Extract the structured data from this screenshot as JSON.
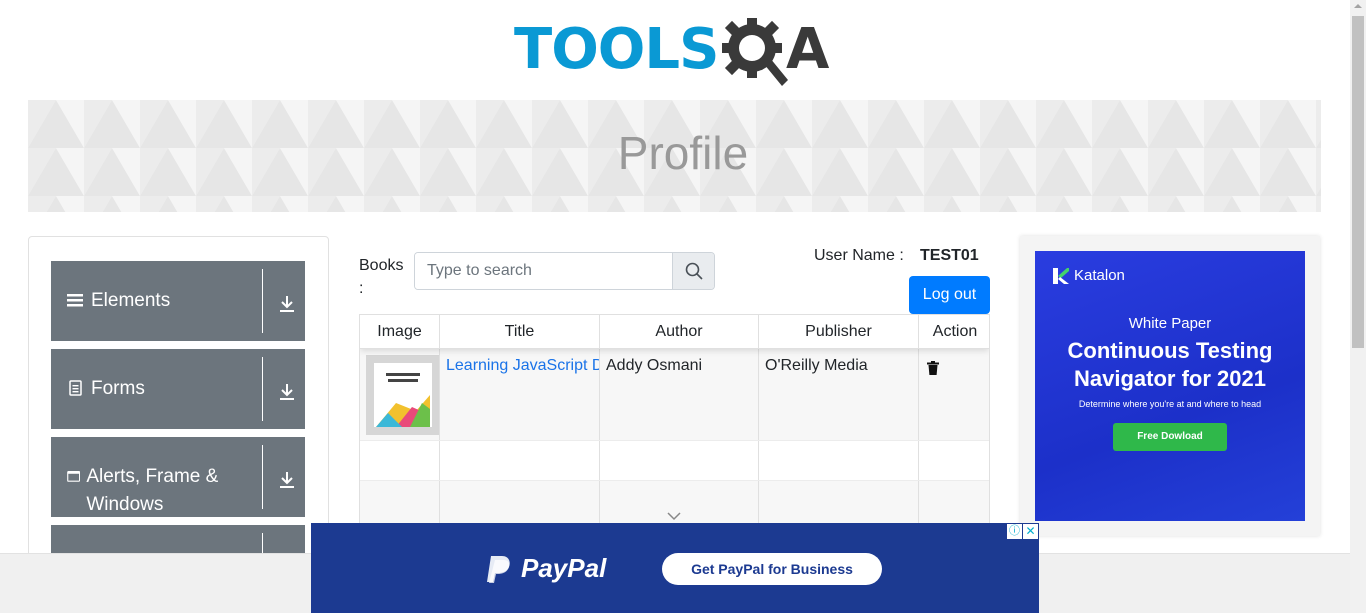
{
  "header": {
    "logo_text": "TOOLS",
    "logo_suffix": "A"
  },
  "banner": {
    "title": "Profile"
  },
  "sidebar": {
    "groups": [
      {
        "label": "Elements",
        "icon": "hamburger-icon"
      },
      {
        "label": "Forms",
        "icon": "document-icon"
      },
      {
        "label": "Alerts, Frame & Windows",
        "icon": "window-icon"
      }
    ]
  },
  "books": {
    "label": "Books :",
    "search_placeholder": "Type to search"
  },
  "user": {
    "label": "User Name :",
    "value": "TEST01",
    "logout_label": "Log out"
  },
  "table": {
    "headers": [
      "Image",
      "Title",
      "Author",
      "Publisher",
      "Action"
    ],
    "rows": [
      {
        "title": "Learning JavaScript Design Patterns",
        "author": "Addy Osmani",
        "publisher": "O'Reilly Media",
        "action_icon": "trash-icon"
      }
    ]
  },
  "ad_right": {
    "brand": "Katalon",
    "kicker": "White Paper",
    "headline": "Continuous Testing Navigator for 2021",
    "sub": "Determine where you're at and where to head",
    "cta": "Free Dowload"
  },
  "ad_bottom": {
    "brand": "PayPal",
    "cta": "Get PayPal for Business",
    "info": "ⓘ",
    "close": "✕"
  },
  "colors": {
    "primary": "#007bff",
    "sidebar": "#6c757d",
    "paypal": "#1c3a91",
    "brand_blue": "#0a99d4"
  }
}
